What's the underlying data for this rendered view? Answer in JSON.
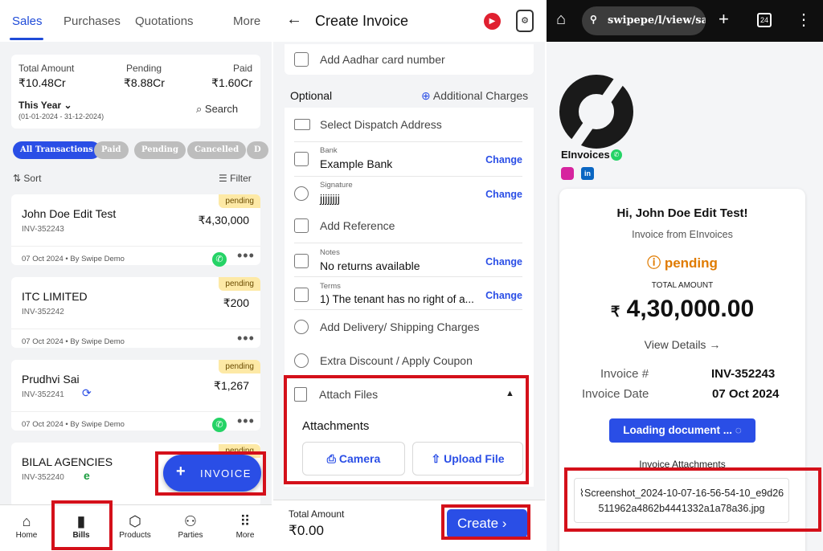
{
  "p1": {
    "tabs": [
      "Sales",
      "Purchases",
      "Quotations",
      "More"
    ],
    "summary": {
      "total_label": "Total Amount",
      "total_value": "₹10.48Cr",
      "pending_label": "Pending",
      "pending_value": "₹8.88Cr",
      "paid_label": "Paid",
      "paid_value": "₹1.60Cr",
      "period": "This Year",
      "range": "(01-01-2024 - 31-12-2024)",
      "search": "Search"
    },
    "chips": [
      "All Transactions",
      "Paid",
      "Pending",
      "Cancelled",
      "D"
    ],
    "sort": "Sort",
    "filter": "Filter",
    "cards": [
      {
        "name": "John Doe Edit Test",
        "inv": "INV-352243",
        "amount": "₹4,30,000",
        "badge": "pending",
        "date": "07 Oct 2024",
        "by": "By Swipe Demo"
      },
      {
        "name": "ITC LIMITED",
        "inv": "INV-352242",
        "amount": "₹200",
        "badge": "pending",
        "date": "07 Oct 2024",
        "by": "By Swipe Demo"
      },
      {
        "name": "Prudhvi Sai",
        "inv": "INV-352241",
        "amount": "₹1,267",
        "badge": "pending",
        "date": "07 Oct 2024",
        "by": "By Swipe Demo"
      },
      {
        "name": "BILAL AGENCIES",
        "inv": "INV-352240",
        "badge": "pending"
      }
    ],
    "fab": "INVOICE",
    "nav": [
      "Home",
      "Bills",
      "Products",
      "Parties",
      "More"
    ]
  },
  "p2": {
    "title": "Create Invoice",
    "aadhar": "Add Aadhar card number",
    "optional": "Optional",
    "additional": "Additional Charges",
    "dispatch": "Select Dispatch Address",
    "bank_small": "Bank",
    "bank": "Example Bank",
    "sig_small": "Signature",
    "sig": "jjjjjjjj",
    "reference": "Add Reference",
    "notes_small": "Notes",
    "notes": "No returns available",
    "terms_small": "Terms",
    "terms": "1) The tenant has no right of a...",
    "delivery": "Add Delivery/ Shipping Charges",
    "discount": "Extra Discount / Apply Coupon",
    "attach": "Attach Files",
    "attachments": "Attachments",
    "camera": "Camera",
    "upload": "Upload File",
    "change": "Change",
    "total_label": "Total Amount",
    "total_value": "₹0.00",
    "create": "Create"
  },
  "p3": {
    "url": "swipepe/l/view/sale",
    "tabcount": "24",
    "company": "EInvoices",
    "greeting": "Hi, John Doe Edit Test!",
    "from": "Invoice from EInvoices",
    "status": "pending",
    "total_label": "TOTAL AMOUNT",
    "total_value": "4,30,000.00",
    "currency": "₹",
    "view_details": "View Details",
    "inv_label": "Invoice #",
    "inv_value": "INV-352243",
    "date_label": "Invoice Date",
    "date_value": "07 Oct 2024",
    "loading": "Loading document ...",
    "attach_heading": "Invoice Attachments",
    "file": "Screenshot_2024-10-07-16-56-54-10_e9d26511962a4862b4441332a1a78a36.jpg"
  },
  "colors": {
    "accent": "#2a4ee6",
    "pending": "#e07b00",
    "highlight": "#d4101a"
  }
}
